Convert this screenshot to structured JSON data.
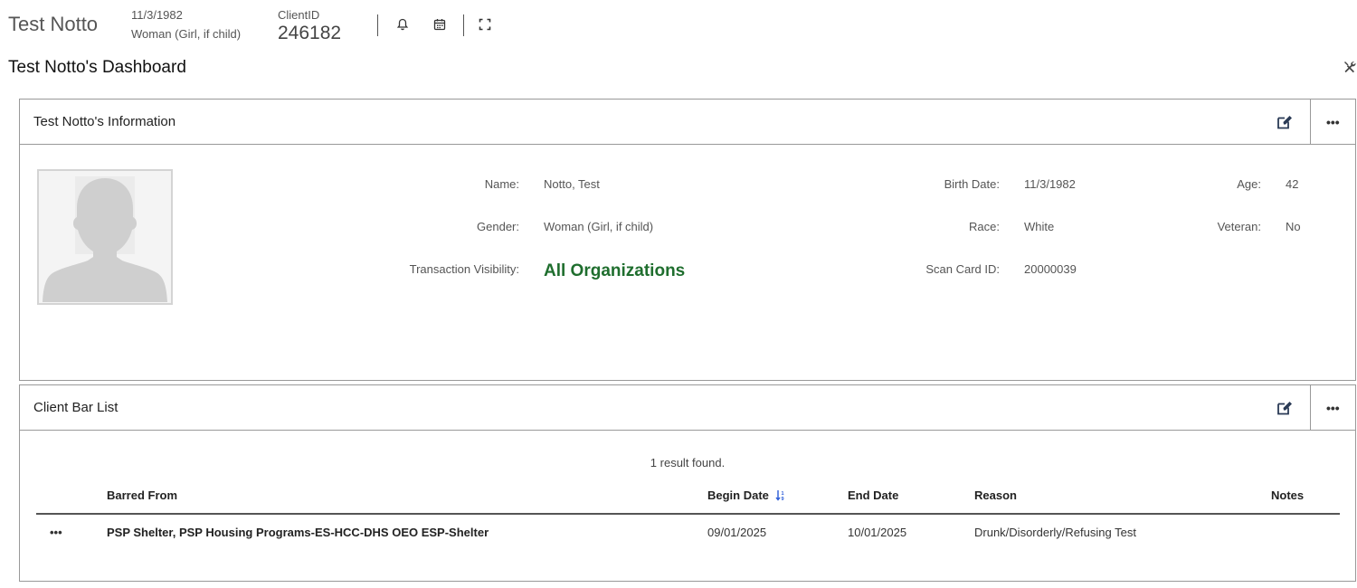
{
  "header": {
    "client_name": "Test Notto",
    "birth_date": "11/3/1982",
    "gender": "Woman (Girl, if child)",
    "client_id_label": "ClientID",
    "client_id": "246182",
    "icons": [
      "bell-icon",
      "calendar-icon",
      "fullscreen-icon"
    ]
  },
  "dashboard": {
    "title": "Test Notto's Dashboard",
    "tools_icon": "tools-icon"
  },
  "info_panel": {
    "title": "Test Notto's Information",
    "fields": {
      "name_label": "Name:",
      "name": "Notto, Test",
      "birth_label": "Birth Date:",
      "birth": "11/3/1982",
      "age_label": "Age:",
      "age": "42",
      "gender_label": "Gender:",
      "gender": "Woman (Girl, if child)",
      "race_label": "Race:",
      "race": "White",
      "veteran_label": "Veteran:",
      "veteran": "No",
      "visibility_label": "Transaction Visibility:",
      "visibility": "All Organizations",
      "scan_label": "Scan Card ID:",
      "scan": "20000039"
    },
    "accent_green": "#1f6e2e"
  },
  "bar_list": {
    "title": "Client Bar List",
    "result_text": "1 result found.",
    "columns": [
      "Barred From",
      "Begin Date",
      "End Date",
      "Reason",
      "Notes"
    ],
    "rows": [
      {
        "barred_from": "PSP Shelter, PSP Housing Programs-ES-HCC-DHS OEO ESP-Shelter",
        "begin_date": "09/01/2025",
        "end_date": "10/01/2025",
        "reason": "Drunk/Disorderly/Refusing Test",
        "notes": ""
      }
    ],
    "sort_icon_color": "#2a5bd7"
  }
}
